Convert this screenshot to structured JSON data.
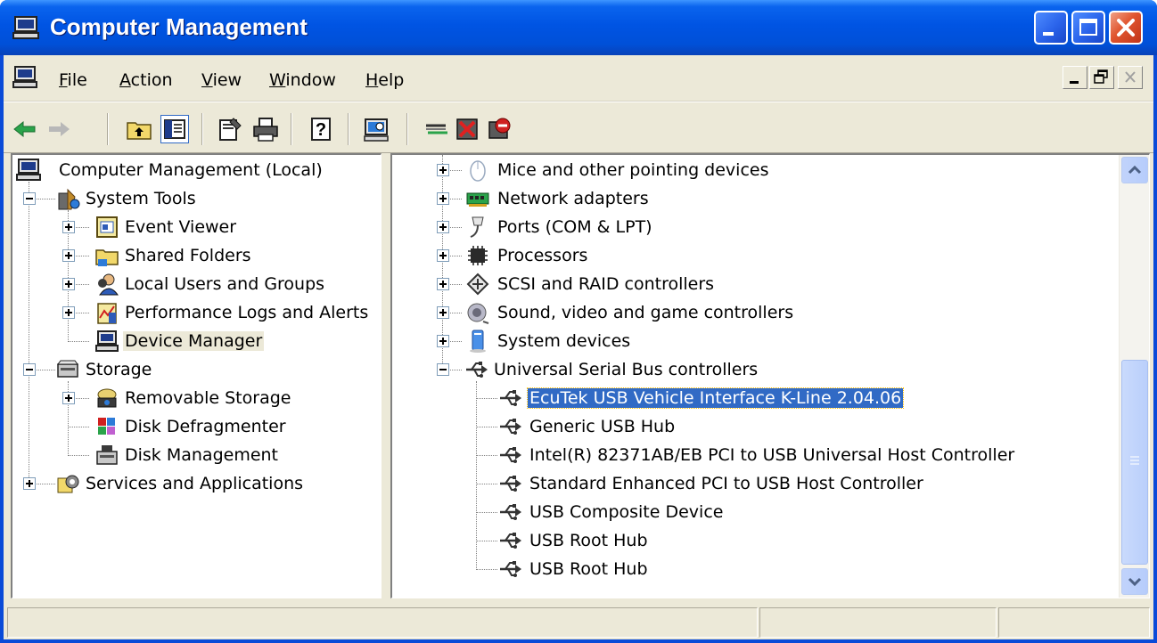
{
  "window": {
    "title": "Computer Management",
    "colors": {
      "titlebar": "#0054E3",
      "selection": "#316AC5",
      "face": "#ECE9D8"
    }
  },
  "menu": {
    "items": [
      {
        "pre": "",
        "key": "F",
        "post": "ile"
      },
      {
        "pre": "",
        "key": "A",
        "post": "ction"
      },
      {
        "pre": "",
        "key": "V",
        "post": "iew"
      },
      {
        "pre": "",
        "key": "W",
        "post": "indow"
      },
      {
        "pre": "",
        "key": "H",
        "post": "elp"
      }
    ]
  },
  "toolbar": {
    "icons": [
      "back-arrow-icon",
      "forward-arrow-icon",
      "up-folder-icon",
      "show-hide-tree-icon",
      "properties-icon",
      "print-icon",
      "help-icon",
      "scan-hardware-icon",
      "update-driver-icon",
      "uninstall-icon",
      "disable-icon"
    ]
  },
  "left_tree": {
    "root": "Computer Management (Local)",
    "system_tools": "System Tools",
    "event_viewer": "Event Viewer",
    "shared_folders": "Shared Folders",
    "local_users": "Local Users and Groups",
    "perf_logs": "Performance Logs and Alerts",
    "device_manager": "Device Manager",
    "storage": "Storage",
    "removable_storage": "Removable Storage",
    "disk_defrag": "Disk Defragmenter",
    "disk_management": "Disk Management",
    "services_apps": "Services and Applications"
  },
  "right_tree": {
    "categories": [
      "Mice and other pointing devices",
      "Network adapters",
      "Ports (COM & LPT)",
      "Processors",
      "SCSI and RAID controllers",
      "Sound, video and game controllers",
      "System devices",
      "Universal Serial Bus controllers"
    ],
    "usb_devices": [
      "EcuTek USB Vehicle Interface K-Line 2.04.06",
      "Generic USB Hub",
      "Intel(R) 82371AB/EB PCI to USB Universal Host Controller",
      "Standard Enhanced PCI to USB Host Controller",
      "USB Composite Device",
      "USB Root Hub",
      "USB Root Hub"
    ]
  }
}
